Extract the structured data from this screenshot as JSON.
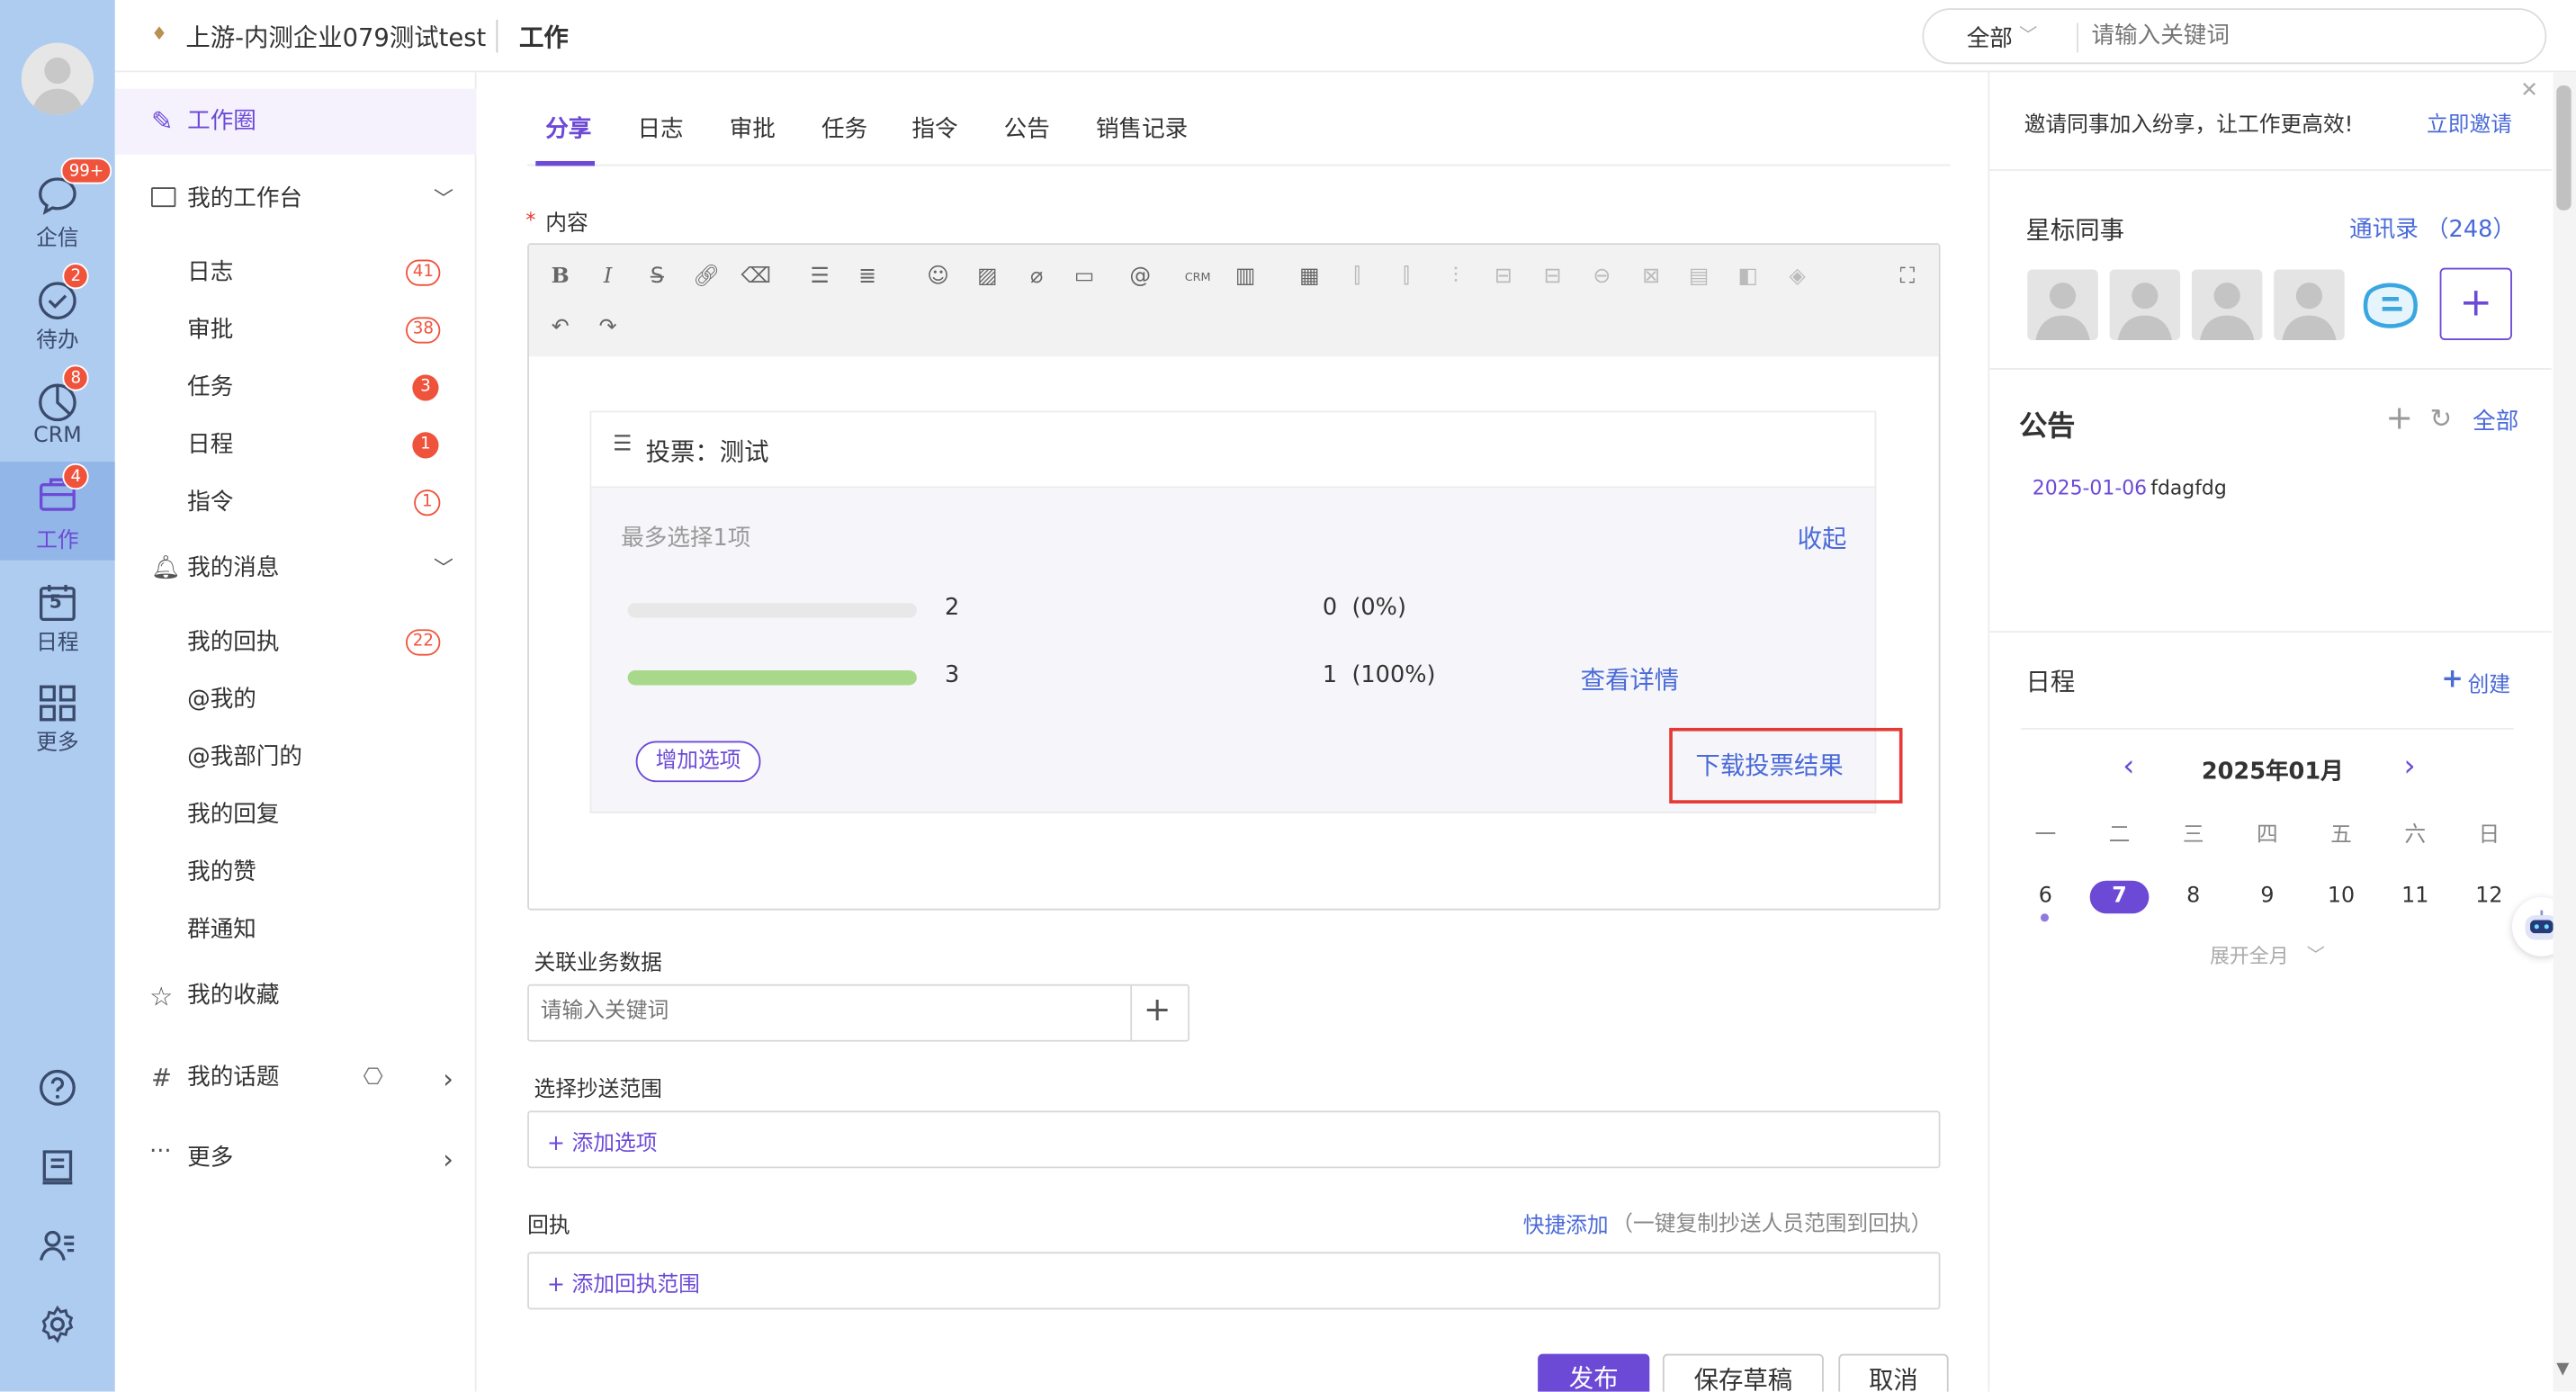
{
  "header": {
    "company": "上游-内测企业079测试test",
    "section": "工作",
    "search_scope": "全部",
    "search_placeholder": "请输入关键词"
  },
  "left_nav": {
    "items": [
      {
        "label": "企信",
        "badge": "99+"
      },
      {
        "label": "待办",
        "badge": "2"
      },
      {
        "label": "CRM",
        "badge": "8"
      },
      {
        "label": "工作",
        "badge": "4"
      },
      {
        "label": "日程",
        "calendar_day": "5"
      },
      {
        "label": "更多"
      }
    ]
  },
  "side_nav": {
    "work_circle": "工作圈",
    "workbench": "我的工作台",
    "workbench_items": [
      {
        "label": "日志",
        "count": "41"
      },
      {
        "label": "审批",
        "count": "38"
      },
      {
        "label": "任务",
        "count": "3"
      },
      {
        "label": "日程",
        "count": "1"
      },
      {
        "label": "指令",
        "count": "1"
      }
    ],
    "messages": "我的消息",
    "message_items": [
      {
        "label": "我的回执",
        "count": "22"
      },
      {
        "label": "@我的"
      },
      {
        "label": "@我部门的"
      },
      {
        "label": "我的回复"
      },
      {
        "label": "我的赞"
      },
      {
        "label": "群通知"
      }
    ],
    "favorites": "我的收藏",
    "topics": "我的话题",
    "more": "更多"
  },
  "main": {
    "tabs": [
      "分享",
      "日志",
      "审批",
      "任务",
      "指令",
      "公告",
      "销售记录"
    ],
    "content_label": "内容",
    "required_mark": "*",
    "vote": {
      "title": "投票：测试",
      "max_select": "最多选择1项",
      "collapse": "收起",
      "options": [
        {
          "name": "2",
          "result": "0  (0%)",
          "fraction": 0.0
        },
        {
          "name": "3",
          "result": "1  (100%)",
          "fraction": 1.0
        }
      ],
      "view_details": "查看详情",
      "add_option": "增加选项",
      "download_results": "下载投票结果"
    },
    "related_data_label": "关联业务数据",
    "related_placeholder": "请输入关键词",
    "cc_scope_label": "选择抄送范围",
    "cc_add": "+ 添加选项",
    "receipt_label": "回执",
    "quick_add": "快捷添加",
    "quick_add_hint": "（一键复制抄送人员范围到回执）",
    "receipt_add": "+ 添加回执范围",
    "publish": "发布",
    "save_draft": "保存草稿",
    "cancel": "取消"
  },
  "right_panel": {
    "invite_text": "邀请同事加入纷享，让工作更高效!",
    "invite_link": "立即邀请",
    "star_colleagues": "星标同事",
    "contacts": "通讯录 （248）",
    "notice_title": "公告",
    "notice_all": "全部",
    "notice_date": "2025-01-06",
    "notice_text": "fdagfdg",
    "schedule_title": "日程",
    "create": "创建",
    "month": "2025年01月",
    "weekdays": [
      "一",
      "二",
      "三",
      "四",
      "五",
      "六",
      "日"
    ],
    "days": [
      "6",
      "7",
      "8",
      "9",
      "10",
      "11",
      "12"
    ],
    "expand_month": "展开全月"
  },
  "colors": {
    "accent": "#6d4ad6",
    "link": "#4a6ad8",
    "nav_bg": "#aecbf0",
    "badge": "#f0533c",
    "vote_bar": "#a8d98a",
    "highlight_box": "#e53935"
  }
}
